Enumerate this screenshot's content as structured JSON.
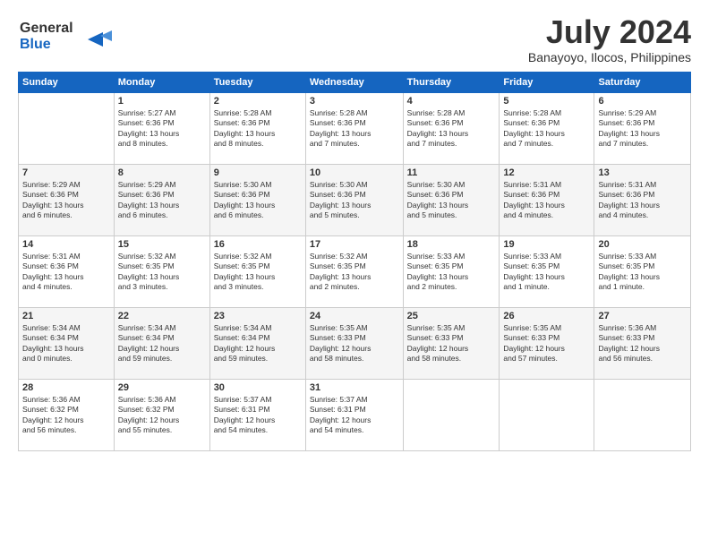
{
  "header": {
    "logo_line1": "General",
    "logo_line2": "Blue",
    "month_title": "July 2024",
    "location": "Banayoyo, Ilocos, Philippines"
  },
  "weekdays": [
    "Sunday",
    "Monday",
    "Tuesday",
    "Wednesday",
    "Thursday",
    "Friday",
    "Saturday"
  ],
  "weeks": [
    [
      {
        "day": "",
        "info": ""
      },
      {
        "day": "1",
        "info": "Sunrise: 5:27 AM\nSunset: 6:36 PM\nDaylight: 13 hours\nand 8 minutes."
      },
      {
        "day": "2",
        "info": "Sunrise: 5:28 AM\nSunset: 6:36 PM\nDaylight: 13 hours\nand 8 minutes."
      },
      {
        "day": "3",
        "info": "Sunrise: 5:28 AM\nSunset: 6:36 PM\nDaylight: 13 hours\nand 7 minutes."
      },
      {
        "day": "4",
        "info": "Sunrise: 5:28 AM\nSunset: 6:36 PM\nDaylight: 13 hours\nand 7 minutes."
      },
      {
        "day": "5",
        "info": "Sunrise: 5:28 AM\nSunset: 6:36 PM\nDaylight: 13 hours\nand 7 minutes."
      },
      {
        "day": "6",
        "info": "Sunrise: 5:29 AM\nSunset: 6:36 PM\nDaylight: 13 hours\nand 7 minutes."
      }
    ],
    [
      {
        "day": "7",
        "info": "Sunrise: 5:29 AM\nSunset: 6:36 PM\nDaylight: 13 hours\nand 6 minutes."
      },
      {
        "day": "8",
        "info": "Sunrise: 5:29 AM\nSunset: 6:36 PM\nDaylight: 13 hours\nand 6 minutes."
      },
      {
        "day": "9",
        "info": "Sunrise: 5:30 AM\nSunset: 6:36 PM\nDaylight: 13 hours\nand 6 minutes."
      },
      {
        "day": "10",
        "info": "Sunrise: 5:30 AM\nSunset: 6:36 PM\nDaylight: 13 hours\nand 5 minutes."
      },
      {
        "day": "11",
        "info": "Sunrise: 5:30 AM\nSunset: 6:36 PM\nDaylight: 13 hours\nand 5 minutes."
      },
      {
        "day": "12",
        "info": "Sunrise: 5:31 AM\nSunset: 6:36 PM\nDaylight: 13 hours\nand 4 minutes."
      },
      {
        "day": "13",
        "info": "Sunrise: 5:31 AM\nSunset: 6:36 PM\nDaylight: 13 hours\nand 4 minutes."
      }
    ],
    [
      {
        "day": "14",
        "info": "Sunrise: 5:31 AM\nSunset: 6:36 PM\nDaylight: 13 hours\nand 4 minutes."
      },
      {
        "day": "15",
        "info": "Sunrise: 5:32 AM\nSunset: 6:35 PM\nDaylight: 13 hours\nand 3 minutes."
      },
      {
        "day": "16",
        "info": "Sunrise: 5:32 AM\nSunset: 6:35 PM\nDaylight: 13 hours\nand 3 minutes."
      },
      {
        "day": "17",
        "info": "Sunrise: 5:32 AM\nSunset: 6:35 PM\nDaylight: 13 hours\nand 2 minutes."
      },
      {
        "day": "18",
        "info": "Sunrise: 5:33 AM\nSunset: 6:35 PM\nDaylight: 13 hours\nand 2 minutes."
      },
      {
        "day": "19",
        "info": "Sunrise: 5:33 AM\nSunset: 6:35 PM\nDaylight: 13 hours\nand 1 minute."
      },
      {
        "day": "20",
        "info": "Sunrise: 5:33 AM\nSunset: 6:35 PM\nDaylight: 13 hours\nand 1 minute."
      }
    ],
    [
      {
        "day": "21",
        "info": "Sunrise: 5:34 AM\nSunset: 6:34 PM\nDaylight: 13 hours\nand 0 minutes."
      },
      {
        "day": "22",
        "info": "Sunrise: 5:34 AM\nSunset: 6:34 PM\nDaylight: 12 hours\nand 59 minutes."
      },
      {
        "day": "23",
        "info": "Sunrise: 5:34 AM\nSunset: 6:34 PM\nDaylight: 12 hours\nand 59 minutes."
      },
      {
        "day": "24",
        "info": "Sunrise: 5:35 AM\nSunset: 6:33 PM\nDaylight: 12 hours\nand 58 minutes."
      },
      {
        "day": "25",
        "info": "Sunrise: 5:35 AM\nSunset: 6:33 PM\nDaylight: 12 hours\nand 58 minutes."
      },
      {
        "day": "26",
        "info": "Sunrise: 5:35 AM\nSunset: 6:33 PM\nDaylight: 12 hours\nand 57 minutes."
      },
      {
        "day": "27",
        "info": "Sunrise: 5:36 AM\nSunset: 6:33 PM\nDaylight: 12 hours\nand 56 minutes."
      }
    ],
    [
      {
        "day": "28",
        "info": "Sunrise: 5:36 AM\nSunset: 6:32 PM\nDaylight: 12 hours\nand 56 minutes."
      },
      {
        "day": "29",
        "info": "Sunrise: 5:36 AM\nSunset: 6:32 PM\nDaylight: 12 hours\nand 55 minutes."
      },
      {
        "day": "30",
        "info": "Sunrise: 5:37 AM\nSunset: 6:31 PM\nDaylight: 12 hours\nand 54 minutes."
      },
      {
        "day": "31",
        "info": "Sunrise: 5:37 AM\nSunset: 6:31 PM\nDaylight: 12 hours\nand 54 minutes."
      },
      {
        "day": "",
        "info": ""
      },
      {
        "day": "",
        "info": ""
      },
      {
        "day": "",
        "info": ""
      }
    ]
  ]
}
